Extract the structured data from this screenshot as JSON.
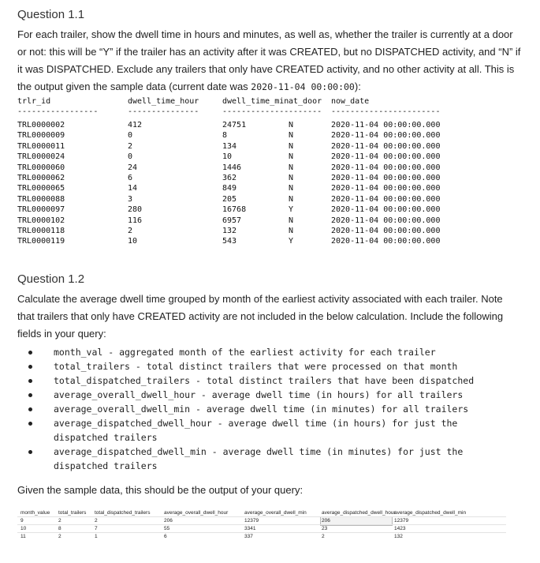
{
  "q11": {
    "title": "Question 1.1",
    "paragraph": "For each trailer, show the dwell time in hours and minutes, as well as, whether the trailer is currently at a door or not: this will be “Y” if the trailer has an activity after it was CREATED, but no DISPATCHED activity, and “N” if it was DISPATCHED. Exclude any trailers that only have CREATED activity, and no other activity at all. This is the output given the sample data (current date was ",
    "current_date_code": "2020-11-04 00:00:00",
    "paragraph_end": "):",
    "result": {
      "columns": [
        "trlr_id",
        "dwell_time_hour",
        "dwell_time_min",
        "at_door",
        "now_date"
      ],
      "separators": [
        "-----------------",
        "---------------",
        "--------------",
        "-------",
        "-----------------------"
      ],
      "rows": [
        [
          "TRL0000002",
          "412",
          "24751",
          "N",
          "2020-11-04 00:00:00.000"
        ],
        [
          "TRL0000009",
          "0",
          "8",
          "N",
          "2020-11-04 00:00:00.000"
        ],
        [
          "TRL0000011",
          "2",
          "134",
          "N",
          "2020-11-04 00:00:00.000"
        ],
        [
          "TRL0000024",
          "0",
          "10",
          "N",
          "2020-11-04 00:00:00.000"
        ],
        [
          "TRL0000060",
          "24",
          "1446",
          "N",
          "2020-11-04 00:00:00.000"
        ],
        [
          "TRL0000062",
          "6",
          "362",
          "N",
          "2020-11-04 00:00:00.000"
        ],
        [
          "TRL0000065",
          "14",
          "849",
          "N",
          "2020-11-04 00:00:00.000"
        ],
        [
          "TRL0000088",
          "3",
          "205",
          "N",
          "2020-11-04 00:00:00.000"
        ],
        [
          "TRL0000097",
          "280",
          "16768",
          "Y",
          "2020-11-04 00:00:00.000"
        ],
        [
          "TRL0000102",
          "116",
          "6957",
          "N",
          "2020-11-04 00:00:00.000"
        ],
        [
          "TRL0000118",
          "2",
          "132",
          "N",
          "2020-11-04 00:00:00.000"
        ],
        [
          "TRL0000119",
          "10",
          "543",
          "Y",
          "2020-11-04 00:00:00.000"
        ]
      ]
    }
  },
  "q12": {
    "title": "Question 1.2",
    "paragraph": "Calculate the average dwell time grouped by month of the earliest activity associated with each trailer. Note that trailers that only have CREATED activity are not included in the below calculation. Include the following fields in your query:",
    "bullets": [
      "month_val - aggregated month of the earliest activity for each trailer",
      "total_trailers - total distinct trailers that were processed on that month",
      "total_dispatched_trailers - total distinct trailers that have been dispatched",
      "average_overall_dwell_hour - average dwell time (in hours) for all trailers",
      "average_overall_dwell_min - average dwell time (in minutes) for all trailers",
      "average_dispatched_dwell_hour - average dwell time (in hours) for just the dispatched trailers",
      "average_dispatched_dwell_min - average dwell time (in minutes) for just the dispatched trailers"
    ],
    "output_intro": "Given the sample data, this should be the output of your query:",
    "grid": {
      "columns": [
        "month_value",
        "total_trailers",
        "total_dispatched_trailers",
        "average_overall_dwell_hour",
        "average_overall_dwell_min",
        "average_dispatched_dwell_hour",
        "average_dispatched_dwell_min"
      ],
      "rows": [
        [
          "9",
          "2",
          "2",
          "206",
          "12379",
          "206",
          "12379"
        ],
        [
          "10",
          "8",
          "7",
          "55",
          "3341",
          "23",
          "1423"
        ],
        [
          "11",
          "2",
          "1",
          "6",
          "337",
          "2",
          "132"
        ]
      ]
    }
  }
}
